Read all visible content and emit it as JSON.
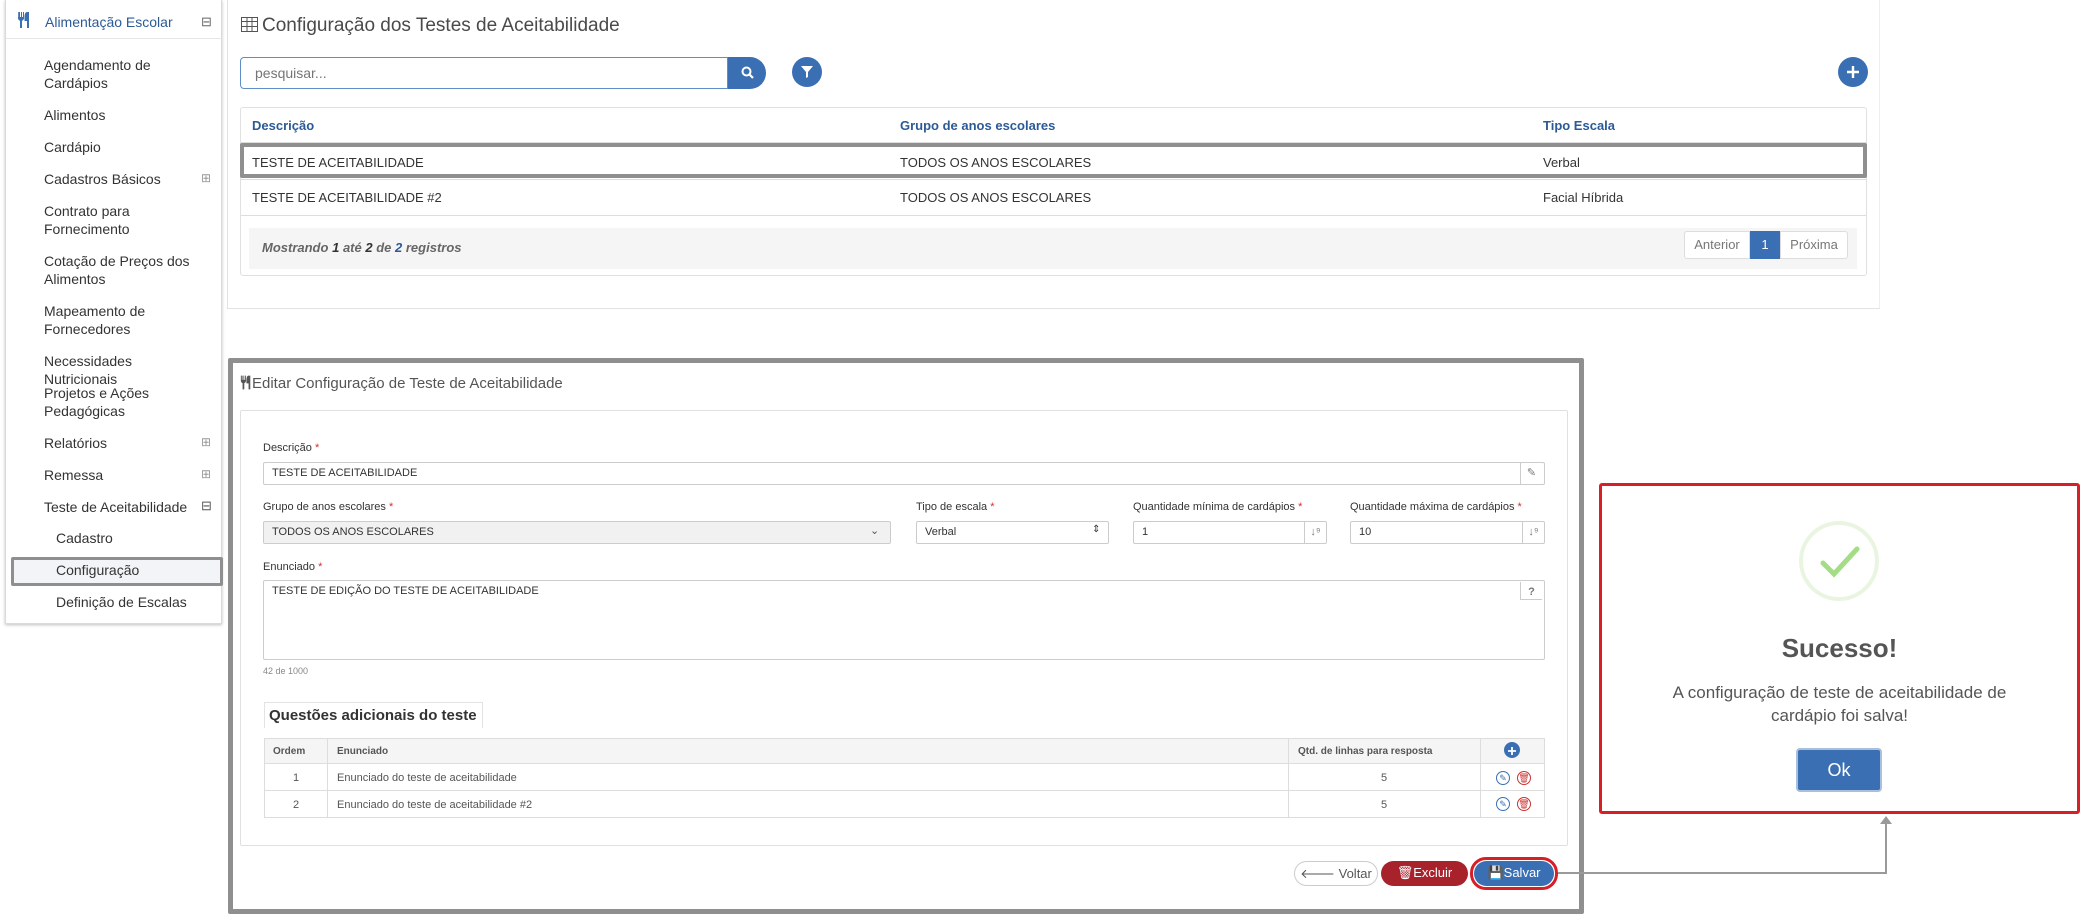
{
  "sidebar": {
    "header": {
      "icon": "utensils-icon",
      "label": "Alimentação Escolar",
      "toggle": "⊟"
    },
    "items": [
      {
        "label": "Agendamento de Cardápios",
        "lines": [
          "Agendamento de",
          "Cardápios"
        ]
      },
      {
        "label": "Alimentos"
      },
      {
        "label": "Cardápio"
      },
      {
        "label": "Cadastros Básicos",
        "toggle": "⊞"
      },
      {
        "label": "Contrato para Fornecimento",
        "lines": [
          "Contrato para",
          "Fornecimento"
        ]
      },
      {
        "label": "Cotação de Preços dos Alimentos",
        "lines": [
          "Cotação de Preços dos",
          "Alimentos"
        ]
      },
      {
        "label": "Mapeamento de Fornecedores",
        "lines": [
          "Mapeamento de",
          "Fornecedores"
        ]
      },
      {
        "label": "Necessidades Nutricionais"
      },
      {
        "label": "Projetos e Ações Pedagógicas",
        "lines": [
          "Projetos e Ações",
          "Pedagógicas"
        ]
      },
      {
        "label": "Relatórios",
        "toggle": "⊞"
      },
      {
        "label": "Remessa",
        "toggle": "⊞"
      },
      {
        "label": "Teste de Aceitabilidade",
        "toggle": "⊟"
      }
    ],
    "subitems": [
      {
        "label": "Cadastro"
      },
      {
        "label": "Configuração",
        "active": true
      },
      {
        "label": "Definição de Escalas"
      }
    ]
  },
  "list_panel": {
    "title_icon": "table-icon",
    "title": "Configuração dos Testes de Aceitabilidade",
    "search_placeholder": "pesquisar...",
    "search_icon": "search-icon",
    "filter_icon": "filter-icon",
    "add_icon": "plus-icon",
    "columns": [
      "Descrição",
      "Grupo de anos escolares",
      "Tipo Escala"
    ],
    "rows": [
      [
        "TESTE DE ACEITABILIDADE",
        "TODOS OS ANOS ESCOLARES",
        "Verbal"
      ],
      [
        "TESTE DE ACEITABILIDADE #2",
        "TODOS OS ANOS ESCOLARES",
        "Facial Híbrida"
      ]
    ],
    "info": {
      "prefix": "Mostrando",
      "from": "1",
      "mid": "até",
      "to": "2",
      "of": "de",
      "total": "2",
      "suffix": "registros"
    },
    "pagination": {
      "prev": "Anterior",
      "current": "1",
      "next": "Próxima"
    }
  },
  "edit_panel": {
    "title_icon": "utensils-icon",
    "title": "Editar Configuração de Teste de Aceitabilidade",
    "fields": {
      "descricao": {
        "label": "Descrição",
        "required": "*",
        "value": "TESTE DE ACEITABILIDADE"
      },
      "grupo": {
        "label": "Grupo de anos escolares",
        "required": "*",
        "value": "TODOS OS ANOS ESCOLARES"
      },
      "tipo": {
        "label": "Tipo de escala",
        "required": "*",
        "value": "Verbal"
      },
      "qmin": {
        "label": "Quantidade mínima de cardápios",
        "required": "*",
        "value": "1"
      },
      "qmax": {
        "label": "Quantidade máxima de cardápios",
        "required": "*",
        "value": "10"
      },
      "enunciado": {
        "label": "Enunciado",
        "required": "*",
        "value": "TESTE DE EDIÇÃO DO TESTE DE ACEITABILIDADE",
        "help": "?",
        "counter": "42 de 1000"
      }
    },
    "questions": {
      "caption": "Questões adicionais do teste",
      "columns": [
        "Ordem",
        "Enunciado",
        "Qtd. de linhas para resposta"
      ],
      "rows": [
        {
          "ordem": "1",
          "enunciado": "Enunciado do teste de aceitabilidade",
          "linhas": "5"
        },
        {
          "ordem": "2",
          "enunciado": "Enunciado do teste de aceitabilidade #2",
          "linhas": "5"
        }
      ]
    },
    "buttons": {
      "voltar": "Voltar",
      "excluir": "Excluir",
      "salvar": "Salvar"
    }
  },
  "modal": {
    "icon": "checkmark-icon",
    "title": "Sucesso!",
    "message_lines": [
      "A configuração de teste de aceitabilidade de",
      "cardápio foi salva!"
    ],
    "ok": "Ok"
  },
  "colors": {
    "primary": "#3a6fb3",
    "danger": "#a8222b",
    "highlight": "#d71f26",
    "success": "#a5dc86"
  }
}
